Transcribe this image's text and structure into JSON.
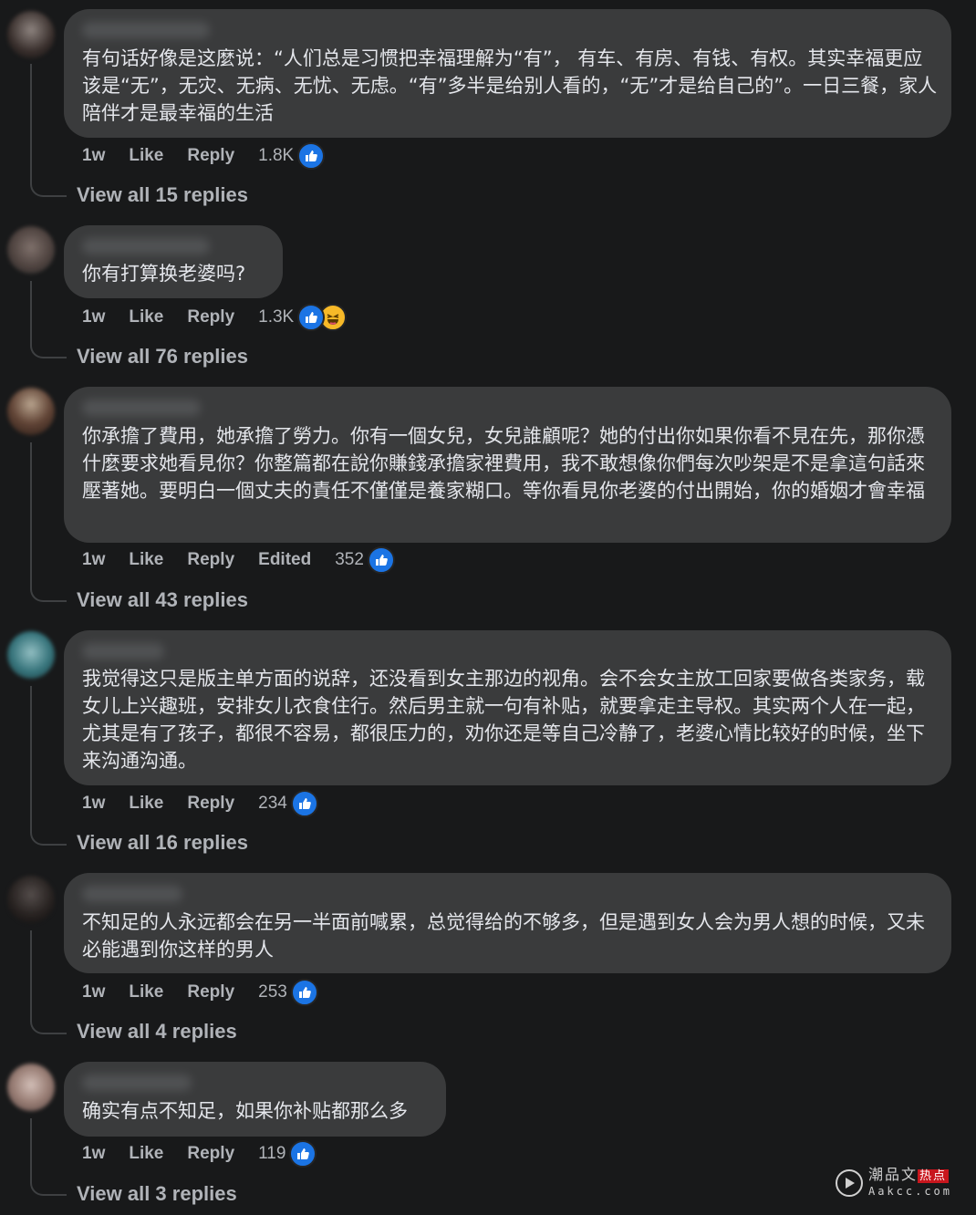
{
  "comments": [
    {
      "body": "有句话好像是这麼说：“人们总是习惯把幸福理解为“有”， 有车、有房、有钱、有权。其实幸福更应该是“无”，无灾、无病、无忧、无虑。“有”多半是给别人看的，“无”才是给自己的”。一日三餐，家人陪伴才是最幸福的生活",
      "time": "1w",
      "like": "Like",
      "reply": "Reply",
      "edited": "",
      "reaction_count": "1.8K",
      "reactions": [
        "like"
      ],
      "view_replies": "View all 15 replies"
    },
    {
      "body": "你有打算换老婆吗?",
      "time": "1w",
      "like": "Like",
      "reply": "Reply",
      "edited": "",
      "reaction_count": "1.3K",
      "reactions": [
        "like",
        "haha"
      ],
      "view_replies": "View all 76 replies"
    },
    {
      "body": "你承擔了費用，她承擔了勞力。你有一個女兒，女兒誰顧呢？她的付出你如果你看不見在先，那你憑什麼要求她看見你？你整篇都在說你賺錢承擔家裡費用，我不敢想像你們每次吵架是不是拿這句話來壓著她。要明白一個丈夫的責任不僅僅是養家糊口。等你看見你老婆的付出開始，你的婚姻才會幸福",
      "time": "1w",
      "like": "Like",
      "reply": "Reply",
      "edited": "Edited",
      "reaction_count": "352",
      "reactions": [
        "like"
      ],
      "view_replies": "View all 43 replies"
    },
    {
      "body": "我觉得这只是版主单方面的说辞，还没看到女主那边的视角。会不会女主放工回家要做各类家务，载女儿上兴趣班，安排女儿衣食住行。然后男主就一句有补贴，就要拿走主导权。其实两个人在一起，尤其是有了孩子，都很不容易，都很压力的，劝你还是等自己冷静了，老婆心情比较好的时候，坐下来沟通沟通。",
      "time": "1w",
      "like": "Like",
      "reply": "Reply",
      "edited": "",
      "reaction_count": "234",
      "reactions": [
        "like"
      ],
      "view_replies": "View all 16 replies"
    },
    {
      "body": "不知足的人永远都会在另一半面前喊累，总觉得给的不够多，但是遇到女人会为男人想的时候，又未必能遇到你这样的男人",
      "time": "1w",
      "like": "Like",
      "reply": "Reply",
      "edited": "",
      "reaction_count": "253",
      "reactions": [
        "like"
      ],
      "view_replies": "View all 4 replies"
    },
    {
      "body": "确实有点不知足，如果你补贴都那么多",
      "time": "1w",
      "like": "Like",
      "reply": "Reply",
      "edited": "",
      "reaction_count": "119",
      "reactions": [
        "like"
      ],
      "view_replies": "View all 3 replies"
    }
  ],
  "watermark": {
    "top": "潮品文",
    "badge": "热点",
    "bottom": "Aakcc.com"
  },
  "colors": {
    "background": "#18191a",
    "bubble": "#3a3b3c",
    "like_blue": "#1b74e4",
    "meta_text": "#b0b3b8"
  },
  "icons": {
    "like": "thumbs-up-icon",
    "haha": "haha-emoji-icon",
    "play": "play-icon"
  }
}
